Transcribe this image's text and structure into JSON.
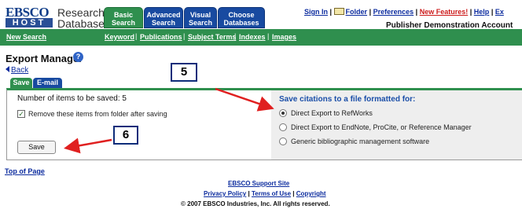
{
  "logo": {
    "top": "EBSCO",
    "bottom": "HOST",
    "text_line1": "Research",
    "text_line2": "Databases"
  },
  "tabs": [
    {
      "line1": "Basic",
      "line2": "Search"
    },
    {
      "line1": "Advanced",
      "line2": "Search"
    },
    {
      "line1": "Visual",
      "line2": "Search"
    },
    {
      "line1": "Choose",
      "line2": "Databases"
    }
  ],
  "top_links": {
    "sign_in": "Sign In",
    "folder": "Folder",
    "preferences": "Preferences",
    "new_features": "New Features!",
    "help": "Help",
    "extra": "Ex",
    "account": "Publisher Demonstration Account"
  },
  "nav": {
    "new_search": "New Search",
    "keyword": "Keyword",
    "publications": "Publications",
    "subject_terms": "Subject Terms",
    "indexes": "Indexes",
    "images": "Images"
  },
  "page": {
    "title": "Export Manager",
    "help": "?",
    "back": "Back"
  },
  "callouts": {
    "five": "5",
    "six": "6"
  },
  "subtabs": {
    "save": "Save",
    "email": "E-mail"
  },
  "left": {
    "items_label": "Number of items to be saved: 5",
    "checkbox_label": "Remove these items from folder after saving",
    "checkbox_checked": true,
    "save_button": "Save"
  },
  "right": {
    "heading": "Save citations to a file formatted for:",
    "options": [
      {
        "label": "Direct Export to RefWorks",
        "selected": true
      },
      {
        "label": "Direct Export to EndNote, ProCite, or Reference Manager",
        "selected": false
      },
      {
        "label": "Generic bibliographic management software",
        "selected": false
      }
    ]
  },
  "footer": {
    "top_of_page": "Top of Page",
    "support": "EBSCO Support Site",
    "privacy": "Privacy Policy",
    "terms": "Terms of Use",
    "copyright": "Copyright",
    "copyright_line": "© 2007 EBSCO Industries, Inc. All rights reserved."
  },
  "colors": {
    "green": "#2f8f4e",
    "blue": "#184aa0",
    "link": "#0b2b9e",
    "arrow": "#e02020"
  }
}
